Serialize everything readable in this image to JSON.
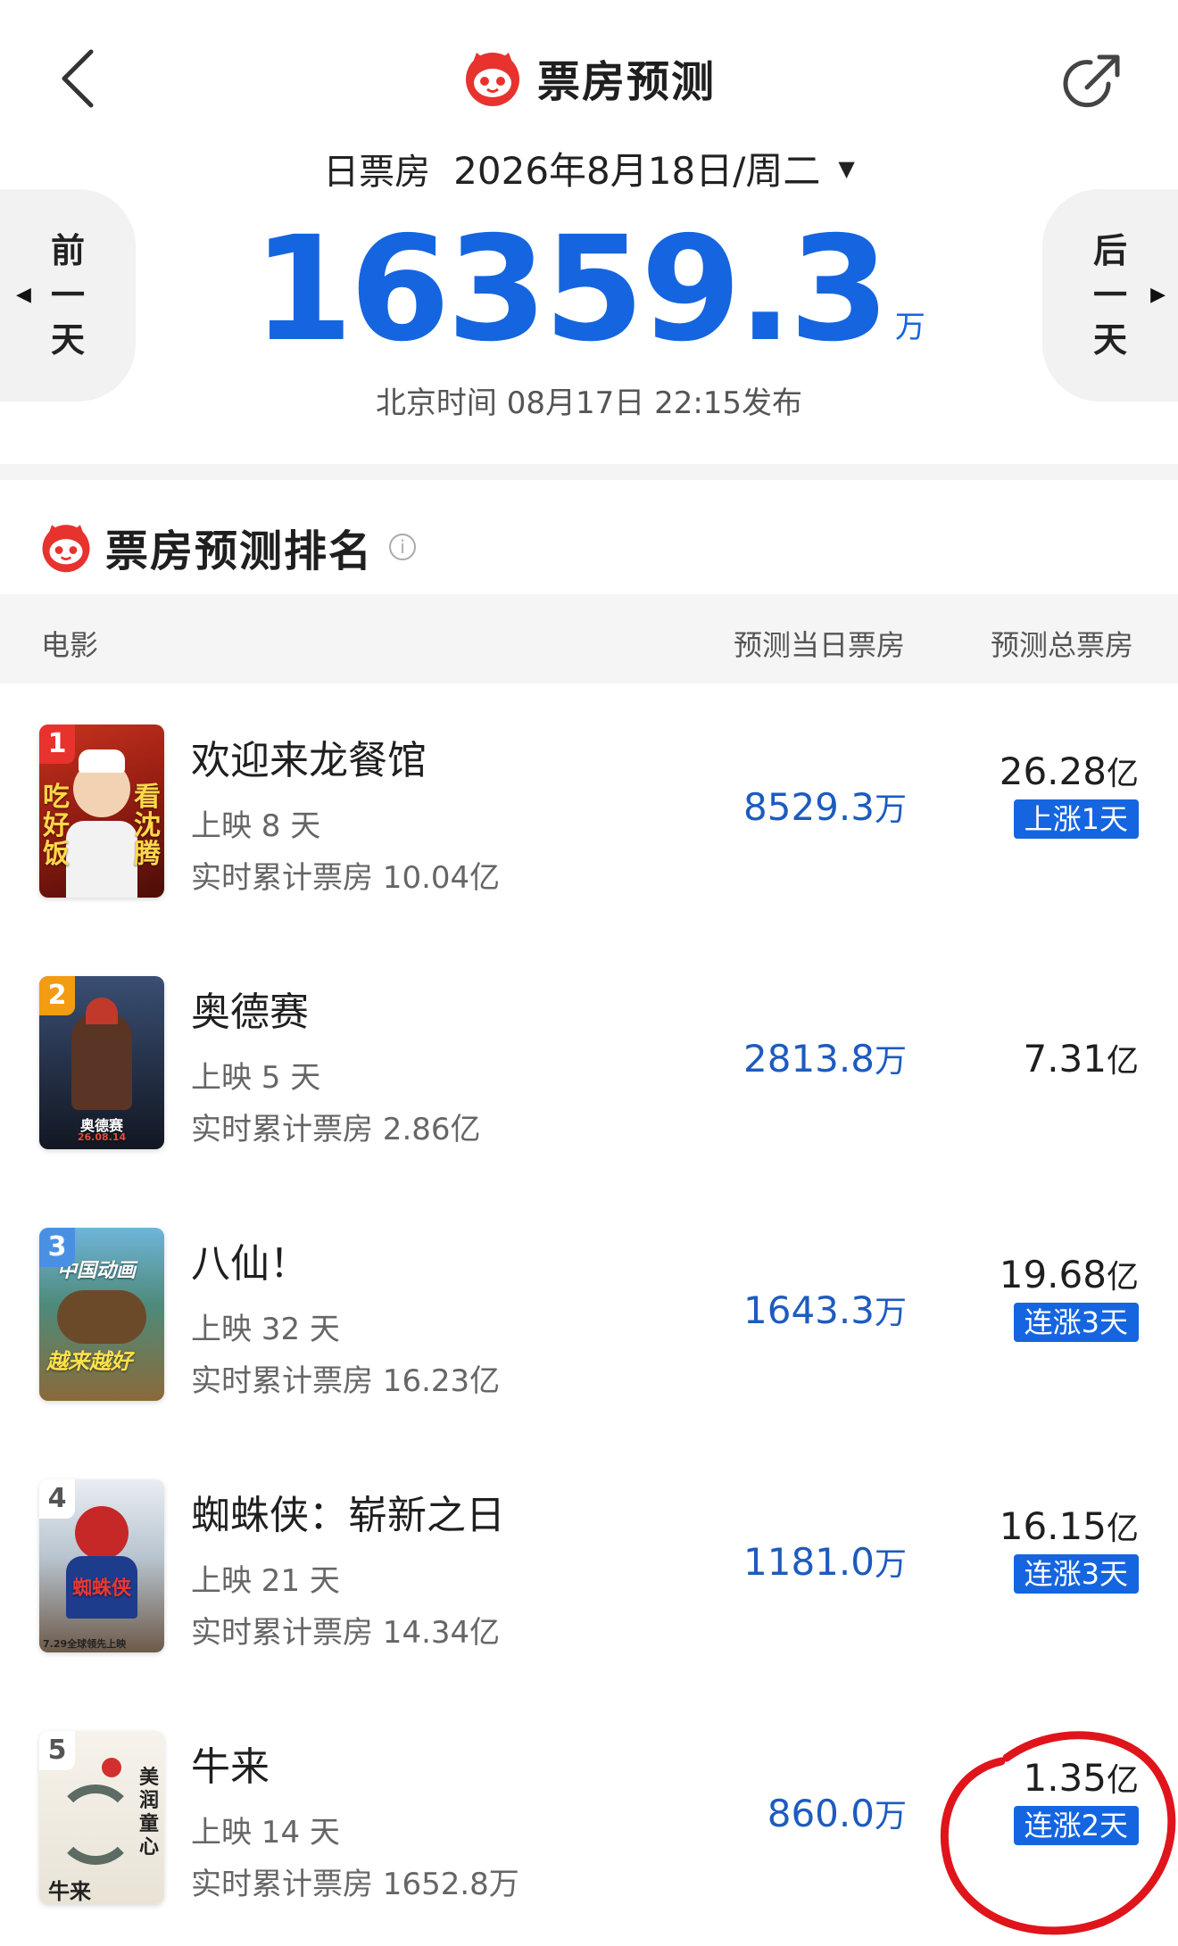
{
  "header": {
    "title": "票房预测",
    "back_icon": "chevron-left-icon",
    "share_icon": "share-icon",
    "logo_icon": "maoyan-cat-icon"
  },
  "date_selector": {
    "label": "日票房",
    "value": "2026年8月18日/周二",
    "caret": "▼"
  },
  "prev_day": {
    "chars": [
      "前",
      "一",
      "天"
    ],
    "arrow": "◀"
  },
  "next_day": {
    "chars": [
      "后",
      "一",
      "天"
    ],
    "arrow": "▶"
  },
  "total": {
    "value": "16359.3",
    "unit": "万",
    "publish_text": "北京时间  08月17日  22:15发布"
  },
  "ranking": {
    "title": "票房预测排名",
    "info_icon": "i",
    "columns": {
      "movie": "电影",
      "day": "预测当日票房",
      "total": "预测总票房"
    },
    "rows": [
      {
        "rank": "1",
        "name": "欢迎来龙餐馆",
        "days": "上映 8 天",
        "cumulative": "实时累计票房 10.04亿",
        "day_value": "8529.3",
        "day_unit": "万",
        "total_value": "26.28",
        "total_unit": "亿",
        "tag": "上涨1天",
        "poster_texts": [
          "吃",
          "好",
          "饭",
          "看",
          "沈",
          "腾"
        ]
      },
      {
        "rank": "2",
        "name": "奥德赛",
        "days": "上映 5 天",
        "cumulative": "实时累计票房 2.86亿",
        "day_value": "2813.8",
        "day_unit": "万",
        "total_value": "7.31",
        "total_unit": "亿",
        "tag": "",
        "poster_texts": [
          "奥德赛",
          "26.08.14"
        ]
      },
      {
        "rank": "3",
        "name": "八仙！",
        "days": "上映 32 天",
        "cumulative": "实时累计票房 16.23亿",
        "day_value": "1643.3",
        "day_unit": "万",
        "total_value": "19.68",
        "total_unit": "亿",
        "tag": "连涨3天",
        "poster_texts": [
          "中国动画",
          "越来越好"
        ]
      },
      {
        "rank": "4",
        "name": "蜘蛛侠：崭新之日",
        "days": "上映 21 天",
        "cumulative": "实时累计票房 14.34亿",
        "day_value": "1181.0",
        "day_unit": "万",
        "total_value": "16.15",
        "total_unit": "亿",
        "tag": "连涨3天",
        "poster_texts": [
          "蜘蛛侠",
          "7.29全球领先上映"
        ]
      },
      {
        "rank": "5",
        "name": "牛来",
        "days": "上映 14 天",
        "cumulative": "实时累计票房 1652.8万",
        "day_value": "860.0",
        "day_unit": "万",
        "total_value": "1.35",
        "total_unit": "亿",
        "tag": "连涨2天",
        "poster_texts": [
          "美",
          "润",
          "童",
          "心",
          "牛来"
        ]
      }
    ]
  },
  "colors": {
    "accent_blue": "#1565e0",
    "value_blue": "#1d5bbf",
    "brand_red": "#e8322e",
    "annotation_red": "#e0141b"
  }
}
